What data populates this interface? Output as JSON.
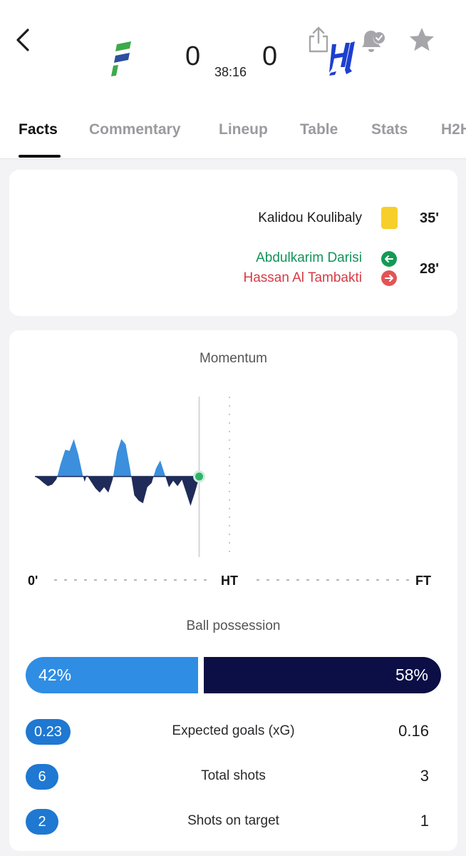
{
  "header": {
    "back_icon": "chevron-left-icon",
    "home_team_logo": "al-fateh-logo",
    "away_team_logo": "al-hilal-logo",
    "home_score": "0",
    "away_score": "0",
    "match_clock": "38:16",
    "share_icon": "share-icon",
    "notification_icon": "bell-check-icon",
    "favorite_icon": "star-icon"
  },
  "tabs": [
    {
      "label": "Facts",
      "active": true
    },
    {
      "label": "Commentary",
      "active": false
    },
    {
      "label": "Lineup",
      "active": false
    },
    {
      "label": "Table",
      "active": false
    },
    {
      "label": "Stats",
      "active": false
    },
    {
      "label": "H2H",
      "active": false
    }
  ],
  "events": {
    "card": {
      "player": "Kalidou Koulibaly",
      "minute": "35'",
      "type": "yellow-card"
    },
    "substitution": {
      "player_in": "Abdulkarim Darisi",
      "player_out": "Hassan Al Tambakti",
      "minute": "28'"
    }
  },
  "momentum": {
    "title": "Momentum",
    "axis": {
      "start": "0'",
      "half": "HT",
      "end": "FT"
    },
    "current_minute": 38,
    "colors": {
      "home": "#3b8fdc",
      "away": "#1f2b59"
    },
    "series": [
      {
        "minute": 0,
        "value": 0
      },
      {
        "minute": 1,
        "value": -0.05
      },
      {
        "minute": 2,
        "value": -0.12
      },
      {
        "minute": 3,
        "value": -0.18
      },
      {
        "minute": 4,
        "value": -0.15
      },
      {
        "minute": 5,
        "value": -0.05
      },
      {
        "minute": 6,
        "value": 0.25
      },
      {
        "minute": 7,
        "value": 0.5
      },
      {
        "minute": 8,
        "value": 0.48
      },
      {
        "minute": 9,
        "value": 0.7
      },
      {
        "minute": 10,
        "value": 0.42
      },
      {
        "minute": 11,
        "value": 0.05
      },
      {
        "minute": 11.5,
        "value": -0.1
      },
      {
        "minute": 12,
        "value": 0.03
      },
      {
        "minute": 13,
        "value": -0.1
      },
      {
        "minute": 14,
        "value": -0.22
      },
      {
        "minute": 15,
        "value": -0.3
      },
      {
        "minute": 16,
        "value": -0.2
      },
      {
        "minute": 17,
        "value": -0.3
      },
      {
        "minute": 18,
        "value": -0.05
      },
      {
        "minute": 19,
        "value": 0.45
      },
      {
        "minute": 20,
        "value": 0.7
      },
      {
        "minute": 21,
        "value": 0.6
      },
      {
        "minute": 22,
        "value": 0.15
      },
      {
        "minute": 23,
        "value": -0.35
      },
      {
        "minute": 24,
        "value": -0.45
      },
      {
        "minute": 25,
        "value": -0.5
      },
      {
        "minute": 26,
        "value": -0.2
      },
      {
        "minute": 27,
        "value": -0.12
      },
      {
        "minute": 28,
        "value": 0.15
      },
      {
        "minute": 29,
        "value": 0.3
      },
      {
        "minute": 30,
        "value": 0.05
      },
      {
        "minute": 31,
        "value": -0.2
      },
      {
        "minute": 32,
        "value": -0.08
      },
      {
        "minute": 33,
        "value": -0.18
      },
      {
        "minute": 34,
        "value": -0.06
      },
      {
        "minute": 35,
        "value": -0.3
      },
      {
        "minute": 36,
        "value": -0.55
      },
      {
        "minute": 37,
        "value": -0.3
      },
      {
        "minute": 38,
        "value": -0.02
      }
    ]
  },
  "possession": {
    "title": "Ball possession",
    "home": 42,
    "away": 58,
    "home_label": "42%",
    "away_label": "58%",
    "colors": {
      "home": "#2f8de4",
      "away": "#0b0f45"
    }
  },
  "stats": [
    {
      "label": "Expected goals (xG)",
      "home": "0.23",
      "away": "0.16"
    },
    {
      "label": "Total shots",
      "home": "6",
      "away": "3"
    },
    {
      "label": "Shots on target",
      "home": "2",
      "away": "1"
    }
  ]
}
